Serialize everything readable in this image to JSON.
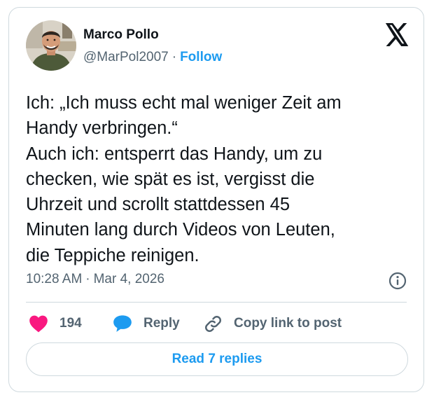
{
  "author": {
    "name": "Marco Pollo",
    "handle": "@MarPol2007",
    "separator": "·",
    "follow_label": "Follow"
  },
  "post": {
    "lines": [
      "Ich: „Ich muss echt mal weniger Zeit am",
      "Handy verbringen.“",
      "Auch ich: entsperrt das Handy, um zu",
      "checken, wie spät es ist, vergisst die",
      "Uhrzeit und scrollt stattdessen 45",
      "Minuten lang durch Videos von Leuten,",
      "die Teppiche reinigen."
    ],
    "time": "10:28 AM",
    "separator": "·",
    "date": "Mar 4, 2026"
  },
  "actions": {
    "like_count": "194",
    "reply_label": "Reply",
    "copy_label": "Copy link to post"
  },
  "read_replies_label": "Read 7 replies",
  "icons": {
    "platform": "x-logo-icon",
    "info": "info-icon",
    "like": "heart-icon",
    "reply": "speech-bubble-icon",
    "copy": "link-icon"
  },
  "colors": {
    "accent": "#1d9bf0",
    "like": "#f91880",
    "text": "#0f1419",
    "secondary": "#536471",
    "border": "#cfd9de"
  }
}
